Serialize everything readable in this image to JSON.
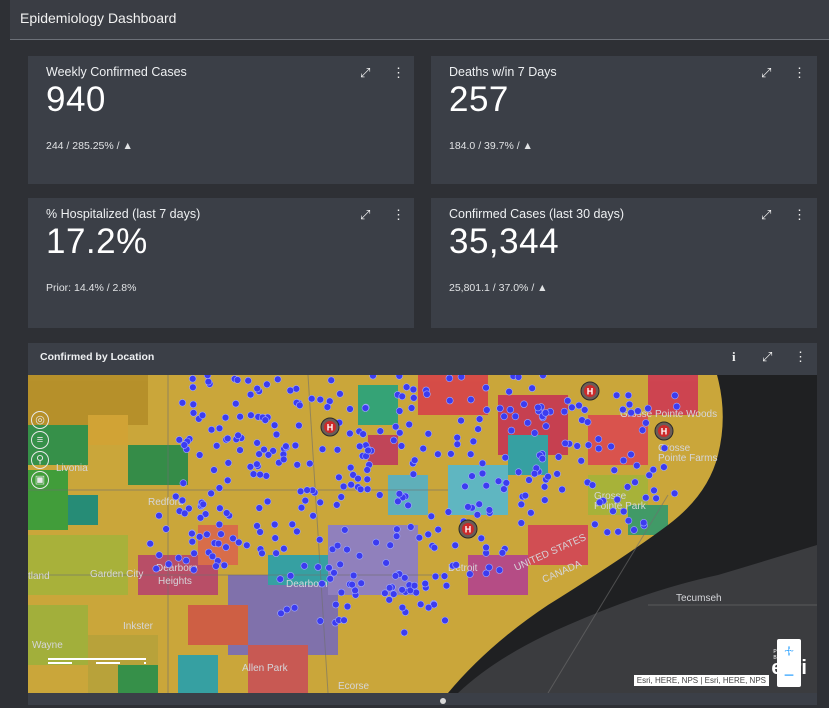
{
  "header": {
    "title": "Epidemiology Dashboard"
  },
  "cards": [
    {
      "title": "Weekly Confirmed Cases",
      "value": "940",
      "sub": "244 / 285.25% / ▲"
    },
    {
      "title": "Deaths w/in 7 Days",
      "value": "257",
      "sub": "184.0 / 39.7% / ▲"
    },
    {
      "title": "% Hospitalized (last 7 days)",
      "value": "17.2%",
      "sub": "Prior: 14.4% / 2.8%"
    },
    {
      "title": "Confirmed Cases (last 30 days)",
      "value": "35,344",
      "sub": "25,801.1 / 37.0% / ▲"
    }
  ],
  "card_tools": {
    "expand": "⤢",
    "menu": "⋮"
  },
  "map": {
    "title": "Confirmed by Location",
    "info_icon": "i",
    "labels": {
      "livonia": "Livonia",
      "redford": "Redford",
      "dearborn_heights": "Dearborn Heights",
      "dearborn": "Dearborn",
      "garden_city": "Garden City",
      "inkster": "Inkster",
      "wayne": "Wayne",
      "westland": "tland",
      "allen_park": "Allen Park",
      "detroit": "Detroit",
      "united_states": "UNITED STATES",
      "canada": "CANADA",
      "grosse_pointe_woods": "Grosse Pointe Woods",
      "grosse_pointe_farms": "Grosse Pointe Farms",
      "grosse_pointe_park": "Grosse Pointe Park",
      "tecumseh": "Tecumseh",
      "ecorse": "Ecorse"
    },
    "zoom_in": "+",
    "zoom_out": "−",
    "attribution": "Esri, HERE, NPS | Esri, HERE, NPS",
    "esri_powered": "POWERED BY",
    "esri_logo": "esri",
    "hospital_marker": "H",
    "tools": [
      "compass-icon",
      "layers-icon",
      "search-icon",
      "basemap-icon"
    ]
  },
  "colors": {
    "card": "#3b3f47",
    "page": "#2e3035",
    "point": "#3c3cf0",
    "water": "#1f2022",
    "hospital": "#cc2a2a"
  }
}
